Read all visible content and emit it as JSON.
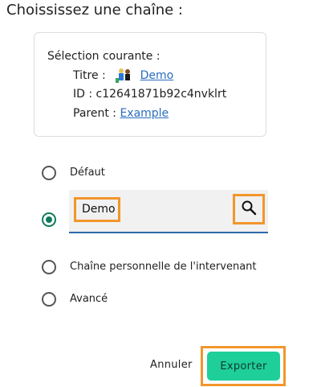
{
  "dialog": {
    "title": "Choississez une chaîne :"
  },
  "current": {
    "heading": "Sélection courante :",
    "title_label": "Titre :",
    "title_link": "Demo",
    "id_label": "ID :",
    "id_value": "c12641871b92c4nvklrt",
    "parent_label": "Parent :",
    "parent_link": "Example"
  },
  "options": [
    {
      "label": "Défaut",
      "checked": false
    },
    {
      "label": "",
      "checked": true
    },
    {
      "label": "Chaîne personnelle de l'intervenant",
      "checked": false
    },
    {
      "label": "Avancé",
      "checked": false
    }
  ],
  "search": {
    "value": "Demo",
    "icon": "search-icon"
  },
  "actions": {
    "cancel_label": "Annuler",
    "export_label": "Exporter"
  },
  "colors": {
    "accent": "#1fcf99",
    "radio_checked": "#0f7a5c",
    "highlight": "#f2962c",
    "link": "#2a6ebd"
  }
}
